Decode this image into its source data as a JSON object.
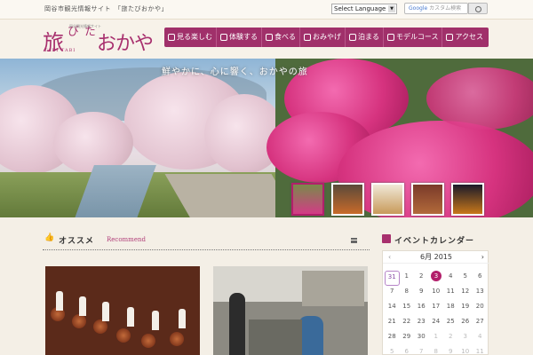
{
  "topbar": {
    "tagline": "岡谷市観光情報サイト　「旅たびおかや」",
    "language_select": "Select Language",
    "search_placeholder_brand": "Google",
    "search_placeholder": "カスタム検索"
  },
  "header": {
    "logo_main": "旅",
    "logo_kana": "たび",
    "logo_name": "おかや",
    "logo_sub": "岡谷観光情報サイト",
    "logo_romaji": "TABI TABI"
  },
  "nav": {
    "items": [
      {
        "label": "見る楽しむ",
        "icon": "eye-icon"
      },
      {
        "label": "体験する",
        "icon": "hand-icon"
      },
      {
        "label": "食べる",
        "icon": "utensils-icon"
      },
      {
        "label": "おみやげ",
        "icon": "gift-icon"
      },
      {
        "label": "泊まる",
        "icon": "bed-icon"
      },
      {
        "label": "モデルコース",
        "icon": "route-icon"
      },
      {
        "label": "アクセス",
        "icon": "bus-icon"
      }
    ]
  },
  "hero": {
    "caption": "鮮やかに、心に響く、おかやの旅"
  },
  "recommend": {
    "title": "オススメ",
    "subtitle": "Recommend"
  },
  "calendar": {
    "title": "イベントカレンダー",
    "month": "6月 2015",
    "prev": "‹",
    "next": "›",
    "weeks": [
      [
        "31",
        "1",
        "2",
        "3",
        "4",
        "5",
        "6"
      ],
      [
        "7",
        "8",
        "9",
        "10",
        "11",
        "12",
        "13"
      ],
      [
        "14",
        "15",
        "16",
        "17",
        "18",
        "19",
        "20"
      ],
      [
        "21",
        "22",
        "23",
        "24",
        "25",
        "26",
        "27"
      ],
      [
        "28",
        "29",
        "30",
        "1",
        "2",
        "3",
        "4"
      ],
      [
        "5",
        "6",
        "7",
        "8",
        "9",
        "10",
        "11"
      ]
    ]
  },
  "colors": {
    "brand": "#a8306e",
    "nav_bg": "#a0306a",
    "today": "#b21f6b"
  }
}
